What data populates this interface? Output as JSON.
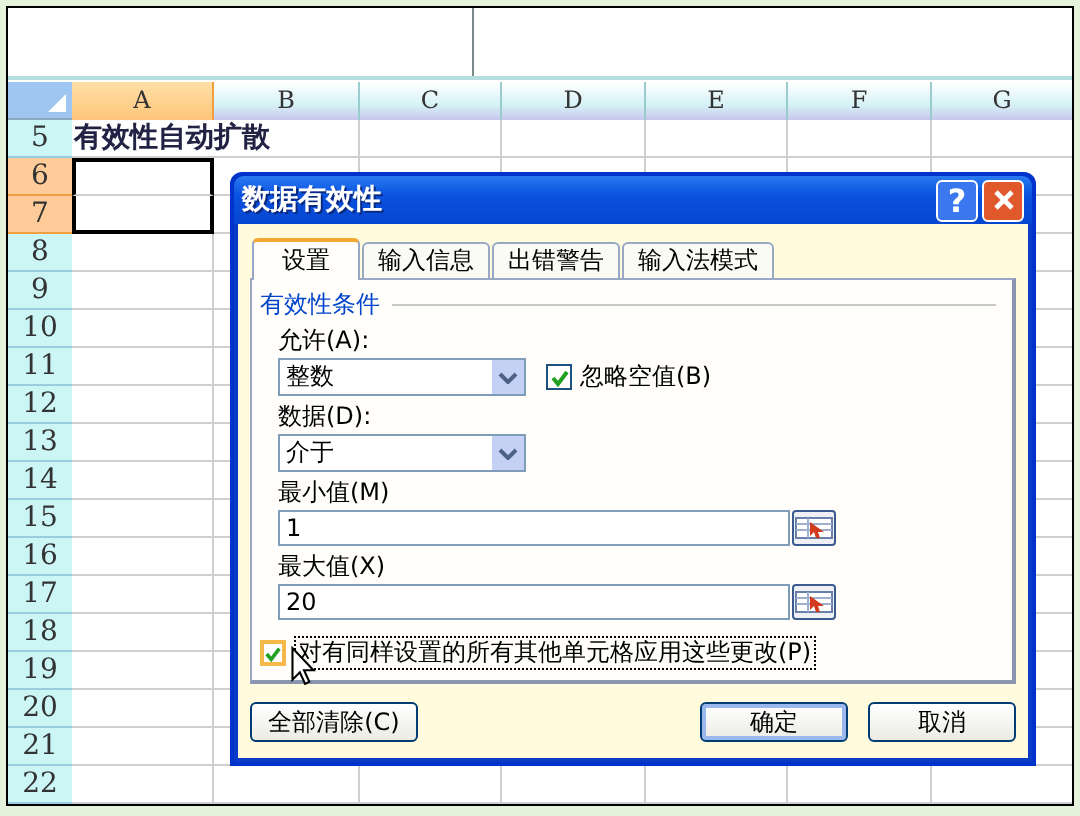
{
  "spreadsheet": {
    "columns": [
      {
        "label": "A",
        "selected": true
      },
      {
        "label": "B",
        "selected": false
      },
      {
        "label": "C",
        "selected": false
      },
      {
        "label": "D",
        "selected": false
      },
      {
        "label": "E",
        "selected": false
      },
      {
        "label": "F",
        "selected": false
      },
      {
        "label": "G",
        "selected": false
      }
    ],
    "rows": [
      {
        "label": "5",
        "selected": false,
        "cell_a": "有效性自动扩散"
      },
      {
        "label": "6",
        "selected": true
      },
      {
        "label": "7",
        "selected": true
      },
      {
        "label": "8",
        "selected": false
      },
      {
        "label": "9",
        "selected": false
      },
      {
        "label": "10",
        "selected": false
      },
      {
        "label": "11",
        "selected": false
      },
      {
        "label": "12",
        "selected": false
      },
      {
        "label": "13",
        "selected": false
      },
      {
        "label": "14",
        "selected": false
      },
      {
        "label": "15",
        "selected": false
      },
      {
        "label": "16",
        "selected": false
      },
      {
        "label": "17",
        "selected": false
      },
      {
        "label": "18",
        "selected": false
      },
      {
        "label": "19",
        "selected": false
      },
      {
        "label": "20",
        "selected": false
      },
      {
        "label": "21",
        "selected": false
      },
      {
        "label": "22",
        "selected": false
      }
    ]
  },
  "dialog": {
    "title": "数据有效性",
    "help_button": "?",
    "tabs": [
      {
        "label": "设置",
        "selected": true
      },
      {
        "label": "输入信息",
        "selected": false
      },
      {
        "label": "出错警告",
        "selected": false
      },
      {
        "label": "输入法模式",
        "selected": false
      }
    ],
    "group_label": "有效性条件",
    "allow": {
      "label": "允许(A):",
      "value": "整数"
    },
    "ignore_blank": {
      "label": "忽略空值(B)",
      "checked": true
    },
    "data": {
      "label": "数据(D):",
      "value": "介于"
    },
    "minimum": {
      "label": "最小值(M)",
      "value": "1"
    },
    "maximum": {
      "label": "最大值(X)",
      "value": "20"
    },
    "apply_all": {
      "label": "对有同样设置的所有其他单元格应用这些更改(P)",
      "checked": true
    },
    "buttons": [
      {
        "label": "全部清除(C)",
        "default": false
      },
      {
        "label": "确定",
        "default": true
      },
      {
        "label": "取消",
        "default": false
      }
    ]
  }
}
